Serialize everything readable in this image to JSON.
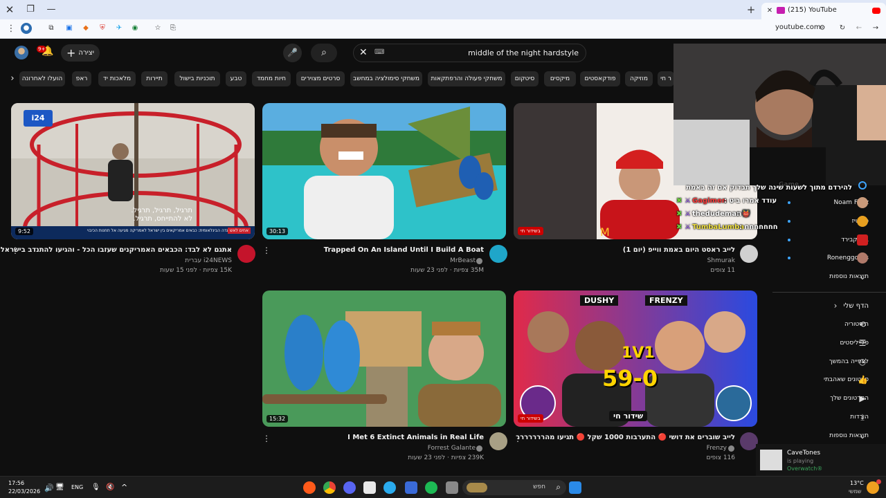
{
  "browser": {
    "tab_title": "(215) YouTube",
    "url": "youtube.com",
    "window_controls": [
      "close-icon",
      "restore-icon",
      "minimize-icon"
    ],
    "new_tab": "+"
  },
  "header": {
    "search_value": "middle of the night hardstyle",
    "create_label": "יצירה",
    "notification_count": "9+",
    "kbd_icon": "keyboard-icon"
  },
  "chips": [
    "הועלו לאחרונה",
    "ראפ",
    "מלאכות יד",
    "תיירות",
    "תוכניות בישול",
    "טבע",
    "חיות מחמד",
    "סרטים מצוירים",
    "משחקי סימולציה במחשב",
    "משחקי פעולה והרפתקאות",
    "סיטקום",
    "מיקסים",
    "פודקאסטים",
    "מוזיקה",
    "ר חי"
  ],
  "videos": [
    {
      "title": "אתגם לא לבד: הכבאים האמריקנים שעזבו הכל - והגיעו להתנדב בישראל",
      "channel": "i24NEWS עברית",
      "stats": "15K צפיות · לפני 15 שעות",
      "duration": "9:52",
      "overlay_text": "תרגיל, תרגיל, תרגיל.\nלא להתייחס, תרגיל.",
      "lower_third": "הבריגדה הבינלאומית: כבאים אמריקאים בין ישראל לאמריקה מגיעה אל תחנות הכיבוי",
      "lower_tag": "אחים לאש",
      "logo": "i24"
    },
    {
      "title": "Trapped On An Island Until I Build A Boat",
      "channel": "MrBeast",
      "stats": "35M צפיות · לפני 23 שעות",
      "duration": "30:13"
    },
    {
      "title": "לייב ראסט היום באמת ווייפ (יום 1)",
      "channel": "Shmurak",
      "stats": "11 צופים",
      "live": "בשידור חי"
    },
    {
      "title": "I Met 6 Extinct Animals in Real Life",
      "channel": "Forrest Galante",
      "stats": "239K צפיות · לפני 23 שעות",
      "duration": "15:32"
    },
    {
      "title": "לייב שוברים את דושי 🔴 התערבות 1000 שקל 🔴 תגיעו מהררררררר",
      "channel": "Frenzy",
      "stats": "116 צופים",
      "live": "בשידור חי",
      "thumb_labels": [
        "DUSHY",
        "FRENZY",
        "1V1",
        "59-0",
        "שידור חי"
      ]
    }
  ],
  "sidebar": {
    "subs": [
      {
        "name": "Noam Firuz"
      },
      {
        "name": "סולטיז"
      },
      {
        "name": "בלאקבירד"
      },
      {
        "name": "Ronenggclips"
      }
    ],
    "more_subs": "תוצאות נוספות",
    "you_header": "הדף שלי",
    "you_items": [
      {
        "label": "היסטוריה",
        "icon": "history-icon"
      },
      {
        "label": "פלייליסטים",
        "icon": "playlist-icon"
      },
      {
        "label": "לצפייה בהמשך",
        "icon": "clock-icon"
      },
      {
        "label": "סרטונים שאהבתי",
        "icon": "like-icon"
      },
      {
        "label": "הסרטונים שלך",
        "icon": "video-icon"
      },
      {
        "label": "הורדות",
        "icon": "download-icon"
      }
    ],
    "more_you": "תוצאות נוספות",
    "partial_top": "Game"
  },
  "chat": [
    {
      "user": "",
      "msg": "להירדם מתוך לשעות שינה שלך תבדוק אם זה באמת",
      "color": "#ffffff"
    },
    {
      "user": "Gagimen",
      "msg": "עודד אמרו ביט :",
      "color": "#ff3b3b"
    },
    {
      "user": "thedudeman",
      "msg": ": 👹",
      "color": "#ffffff"
    },
    {
      "user": "TumbaLumba",
      "msg": ": חחחחחחח",
      "color": "#f0e040"
    }
  ],
  "toast": {
    "name": "CaveTones",
    "status": "is playing",
    "game": "Overwatch®"
  },
  "taskbar": {
    "time": "17:56",
    "date": "22/03/2026",
    "lang": "ENG",
    "search_placeholder": "חפש",
    "weather_temp": "13°C",
    "weather_desc": "שמשי"
  }
}
